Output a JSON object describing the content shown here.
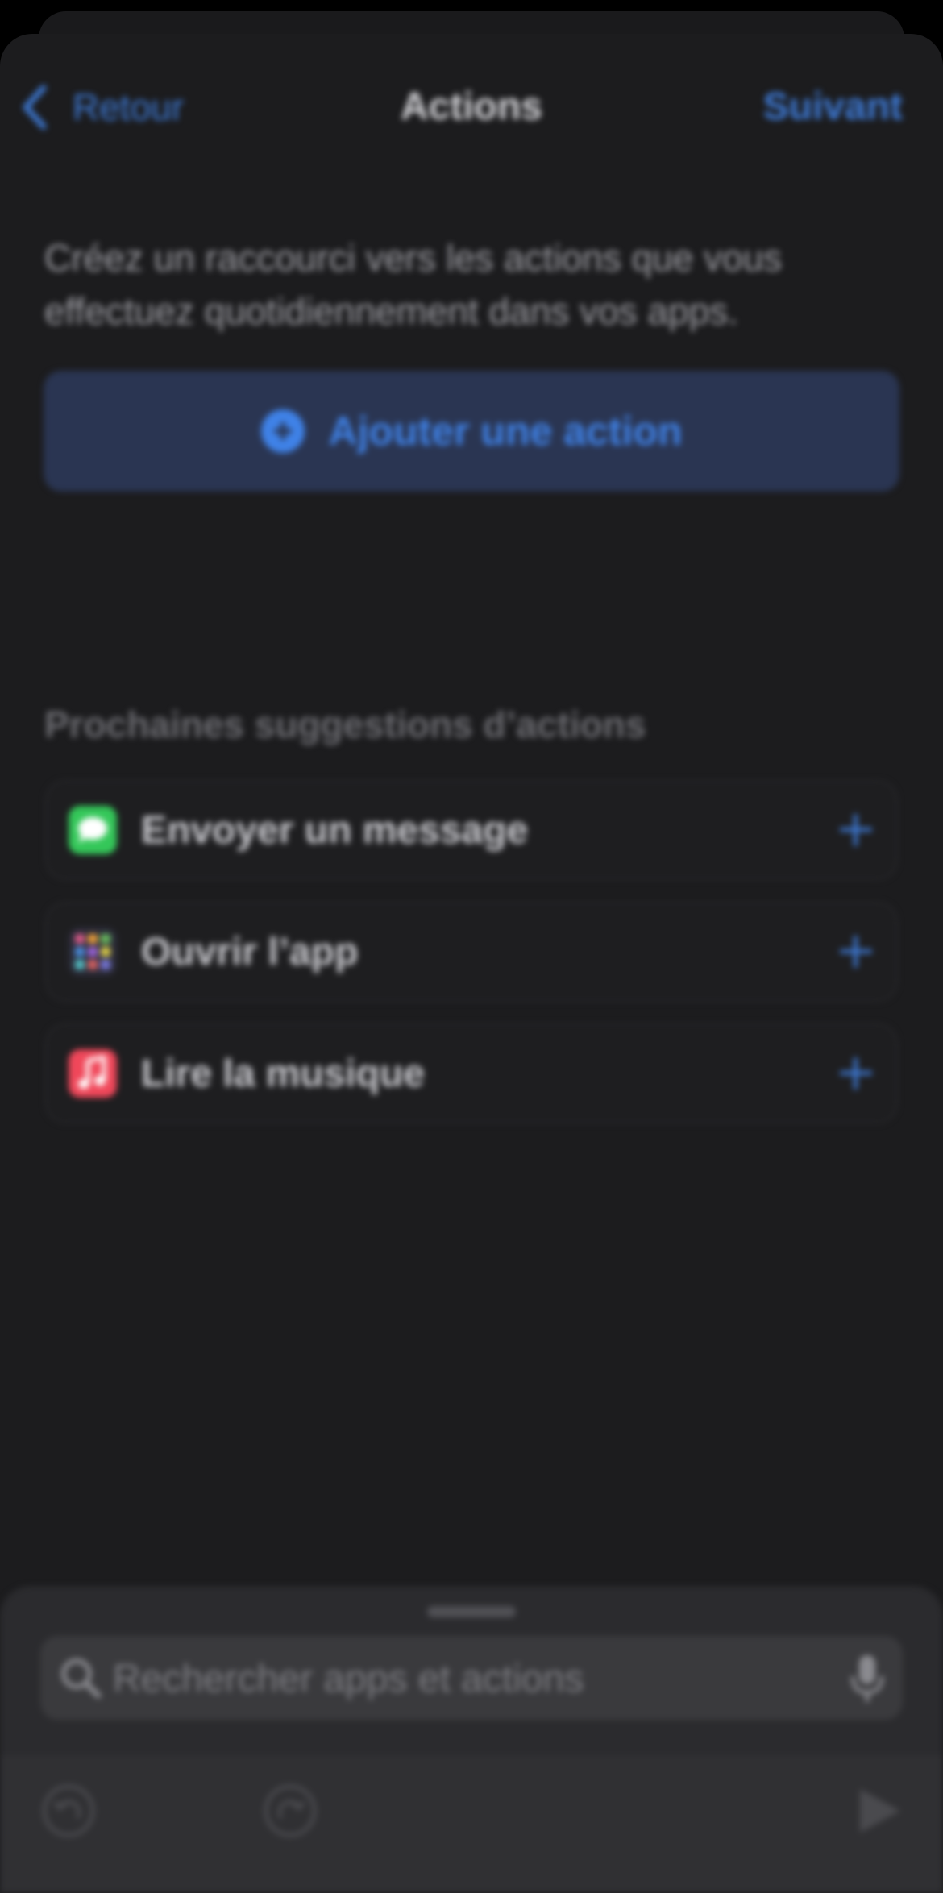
{
  "nav": {
    "back_label": "Retour",
    "title": "Actions",
    "next_label": "Suivant"
  },
  "description": "Créez un raccourci vers les actions que vous effectuez quotidiennement dans vos apps.",
  "add_action": {
    "label": "Ajouter une action"
  },
  "suggestions": {
    "title": "Prochaines suggestions d’actions",
    "items": [
      {
        "label": "Envoyer un message",
        "icon": "messages-app-icon"
      },
      {
        "label": "Ouvrir l’app",
        "icon": "app-grid-icon"
      },
      {
        "label": "Lire la musique",
        "icon": "music-app-icon"
      }
    ]
  },
  "search": {
    "placeholder": "Rechercher apps et actions"
  },
  "toolbar": {
    "undo": "undo-icon",
    "redo": "redo-icon",
    "run": "play-icon"
  },
  "colors": {
    "accent": "#3e7bd8",
    "background": "#1c1c1e",
    "button_bg": "#2a3552"
  }
}
